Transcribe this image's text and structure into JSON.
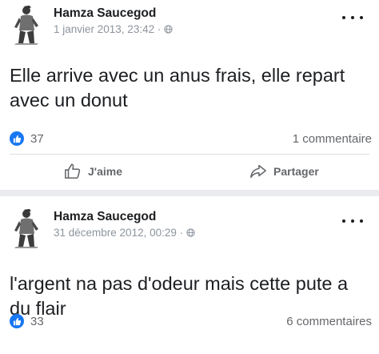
{
  "colors": {
    "like_blue": "#1877f2",
    "text_primary": "#1c1e21",
    "text_secondary": "#65676b",
    "text_meta": "#8d949e",
    "separator": "#e9ebee"
  },
  "posts": [
    {
      "author": "Hamza Saucegod",
      "timestamp": "1 janvier 2013, 23:42 ·",
      "privacy_icon": "globe-icon",
      "more_icon": "more-options-icon",
      "text": "Elle arrive avec un anus frais, elle repart avec un donut",
      "reaction_icon": "like-badge-icon",
      "reactions_count": "37",
      "comments_label": "1 commentaire",
      "actions": {
        "like_label": "J'aime",
        "like_icon": "thumbs-up-icon",
        "share_label": "Partager",
        "share_icon": "share-arrow-icon"
      }
    },
    {
      "author": "Hamza Saucegod",
      "timestamp": "31 décembre 2012, 00:29 ·",
      "privacy_icon": "globe-icon",
      "more_icon": "more-options-icon",
      "text": "l'argent na pas d'odeur mais cette pute a du flair",
      "reaction_icon": "like-badge-icon",
      "reactions_count": "33",
      "comments_label": "6 commentaires"
    }
  ]
}
